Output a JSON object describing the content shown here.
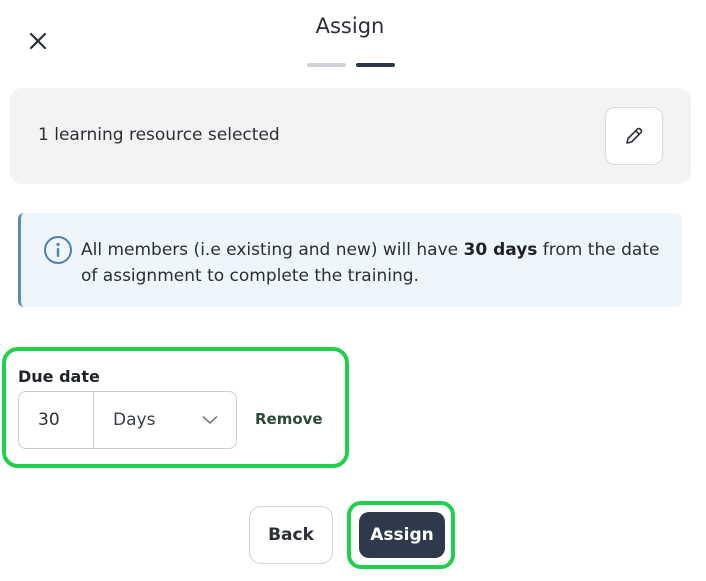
{
  "header": {
    "title": "Assign",
    "close_icon": "close-icon",
    "steps": [
      {
        "state": "complete"
      },
      {
        "state": "active"
      }
    ]
  },
  "resource": {
    "summary": "1 learning resource selected",
    "edit_icon": "pencil-icon"
  },
  "info": {
    "icon": "info-icon",
    "text_before": "All members (i.e existing and new) will have ",
    "text_bold": "30 days",
    "text_after": " from the date of assignment to complete the training."
  },
  "due_date": {
    "label": "Due date",
    "value": "30",
    "unit": "Days",
    "remove_label": "Remove"
  },
  "footer": {
    "back_label": "Back",
    "assign_label": "Assign"
  },
  "colors": {
    "highlight": "#1fd14a",
    "primary_button": "#2e3a4b",
    "info_background": "#eef5fc",
    "info_border": "#5b8ab8",
    "card_background": "#f3f3f4"
  }
}
